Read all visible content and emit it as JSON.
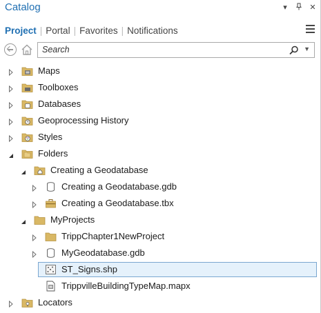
{
  "pane": {
    "title": "Catalog",
    "controls": [
      "▾",
      "⊓",
      "✕"
    ]
  },
  "tabs": [
    {
      "label": "Project",
      "active": true
    },
    {
      "label": "Portal",
      "active": false
    },
    {
      "label": "Favorites",
      "active": false
    },
    {
      "label": "Notifications",
      "active": false
    }
  ],
  "search": {
    "placeholder": "Search",
    "value": "Search"
  },
  "tree": [
    {
      "label": "Maps",
      "level": 0,
      "expanded": false,
      "icon": "map-folder-icon"
    },
    {
      "label": "Toolboxes",
      "level": 0,
      "expanded": false,
      "icon": "toolbox-folder-icon"
    },
    {
      "label": "Databases",
      "level": 0,
      "expanded": false,
      "icon": "database-folder-icon"
    },
    {
      "label": "Geoprocessing History",
      "level": 0,
      "expanded": false,
      "icon": "history-icon"
    },
    {
      "label": "Styles",
      "level": 0,
      "expanded": false,
      "icon": "styles-icon"
    },
    {
      "label": "Folders",
      "level": 0,
      "expanded": true,
      "icon": "folders-icon"
    },
    {
      "label": "Creating a Geodatabase",
      "level": 1,
      "expanded": true,
      "icon": "home-folder-icon"
    },
    {
      "label": "Creating a Geodatabase.gdb",
      "level": 2,
      "expanded": false,
      "icon": "geodatabase-icon"
    },
    {
      "label": "Creating a Geodatabase.tbx",
      "level": 2,
      "expanded": false,
      "icon": "toolbox-icon"
    },
    {
      "label": "MyProjects",
      "level": 1,
      "expanded": true,
      "icon": "folder-icon"
    },
    {
      "label": "TrippChapter1NewProject",
      "level": 2,
      "expanded": false,
      "icon": "folder-icon"
    },
    {
      "label": "MyGeodatabase.gdb",
      "level": 2,
      "expanded": false,
      "icon": "geodatabase-icon"
    },
    {
      "label": "ST_Signs.shp",
      "level": 2,
      "expanded": null,
      "icon": "shapefile-icon",
      "selected": true
    },
    {
      "label": "TrippvilleBuildingTypeMap.mapx",
      "level": 2,
      "expanded": null,
      "icon": "map-file-icon"
    },
    {
      "label": "Locators",
      "level": 0,
      "expanded": false,
      "icon": "locator-folder-icon"
    }
  ],
  "colors": {
    "accent": "#1f6fb2",
    "selection_bg": "#e5f1fb",
    "selection_border": "#7aa6d0",
    "folder": "#d9b865"
  }
}
